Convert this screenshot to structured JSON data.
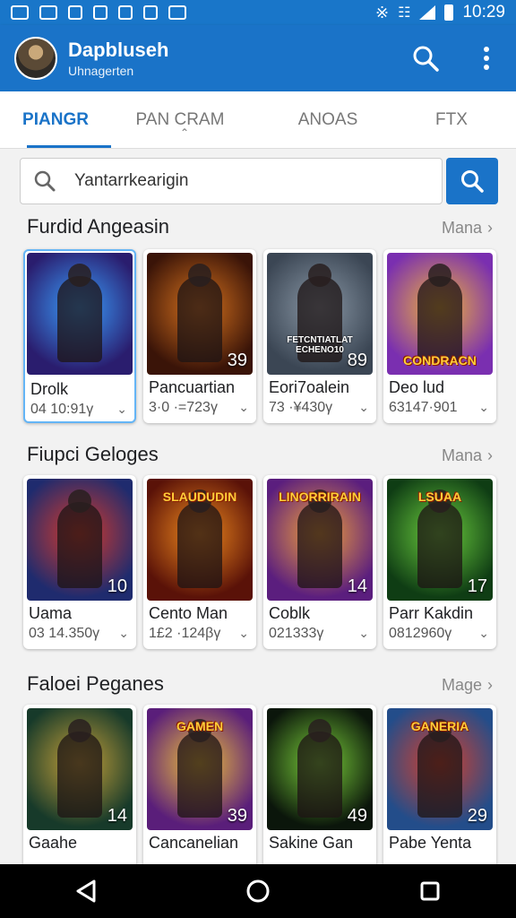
{
  "status_bar": {
    "time": "10:29"
  },
  "app_bar": {
    "title": "Dapbluseh",
    "subtitle": "Uhnagerten"
  },
  "tabs": [
    {
      "label": "PIANGR",
      "active": true
    },
    {
      "label": "PAN CRAM",
      "active": false
    },
    {
      "label": "ANOAS",
      "active": false
    },
    {
      "label": "FTX",
      "active": false
    }
  ],
  "search": {
    "value": "Yantarrkearigin"
  },
  "sections": [
    {
      "title": "Furdid Angeasin",
      "more": "Mana",
      "cards": [
        {
          "name": "Drolk",
          "meta": "04 10:91γ",
          "badge": "",
          "banner": "",
          "colors": [
            "#2a1d6e",
            "#3aa0ff"
          ]
        },
        {
          "name": "Pancuartian",
          "meta": "3·0 ·=723γ",
          "badge": "39",
          "banner": "",
          "colors": [
            "#3a1408",
            "#d8731e"
          ]
        },
        {
          "name": "Eori7oalein",
          "meta": "73 ·¥430γ",
          "badge": "89",
          "banner": "FETCNTIATLAT  ECHENO10",
          "colors": [
            "#3b4654",
            "#8a98a6"
          ]
        },
        {
          "name": "Deo lud",
          "meta": "63147·901",
          "badge": "",
          "banner": "CONDRACN",
          "colors": [
            "#7a2fb0",
            "#f0b43a"
          ]
        }
      ]
    },
    {
      "title": "Fiupci Geloges",
      "more": "Mana",
      "cards": [
        {
          "name": "Uama",
          "meta": "03 14.350γ",
          "badge": "10",
          "banner": "",
          "colors": [
            "#1f2b6e",
            "#d83a2a"
          ]
        },
        {
          "name": "Cento Man",
          "meta": "1£2 ·124βγ",
          "badge": "",
          "banner": "SLAUDUDIN",
          "colors": [
            "#5a1208",
            "#f08a1e"
          ]
        },
        {
          "name": "Coblk",
          "meta": "021333γ",
          "badge": "14",
          "banner": "LINORRIRAIN",
          "colors": [
            "#5b1e7e",
            "#f2a23a"
          ]
        },
        {
          "name": "Parr Kakdin",
          "meta": "0812960γ",
          "badge": "17",
          "banner": "LSUAA",
          "colors": [
            "#0f3d14",
            "#6ccf3e"
          ]
        }
      ]
    },
    {
      "title": "Faloei Peganes",
      "more": "Mage",
      "cards": [
        {
          "name": "Gaahe",
          "meta": "",
          "badge": "14",
          "banner": "",
          "colors": [
            "#173a2a",
            "#c8a23a"
          ]
        },
        {
          "name": "Cancanelian",
          "meta": "",
          "badge": "39",
          "banner": "GAMEN",
          "colors": [
            "#5a1e7a",
            "#f0c23a"
          ]
        },
        {
          "name": "Sakine Gan",
          "meta": "",
          "badge": "49",
          "banner": "",
          "colors": [
            "#0b160b",
            "#7ad03a"
          ]
        },
        {
          "name": "Pabe Yenta",
          "meta": "",
          "badge": "29",
          "banner": "GANERIA",
          "colors": [
            "#234d8a",
            "#d8402a"
          ]
        }
      ]
    }
  ],
  "colors": {
    "primary": "#1a73c8",
    "status_bar": "#1976c9",
    "nav_bar": "#000000"
  }
}
